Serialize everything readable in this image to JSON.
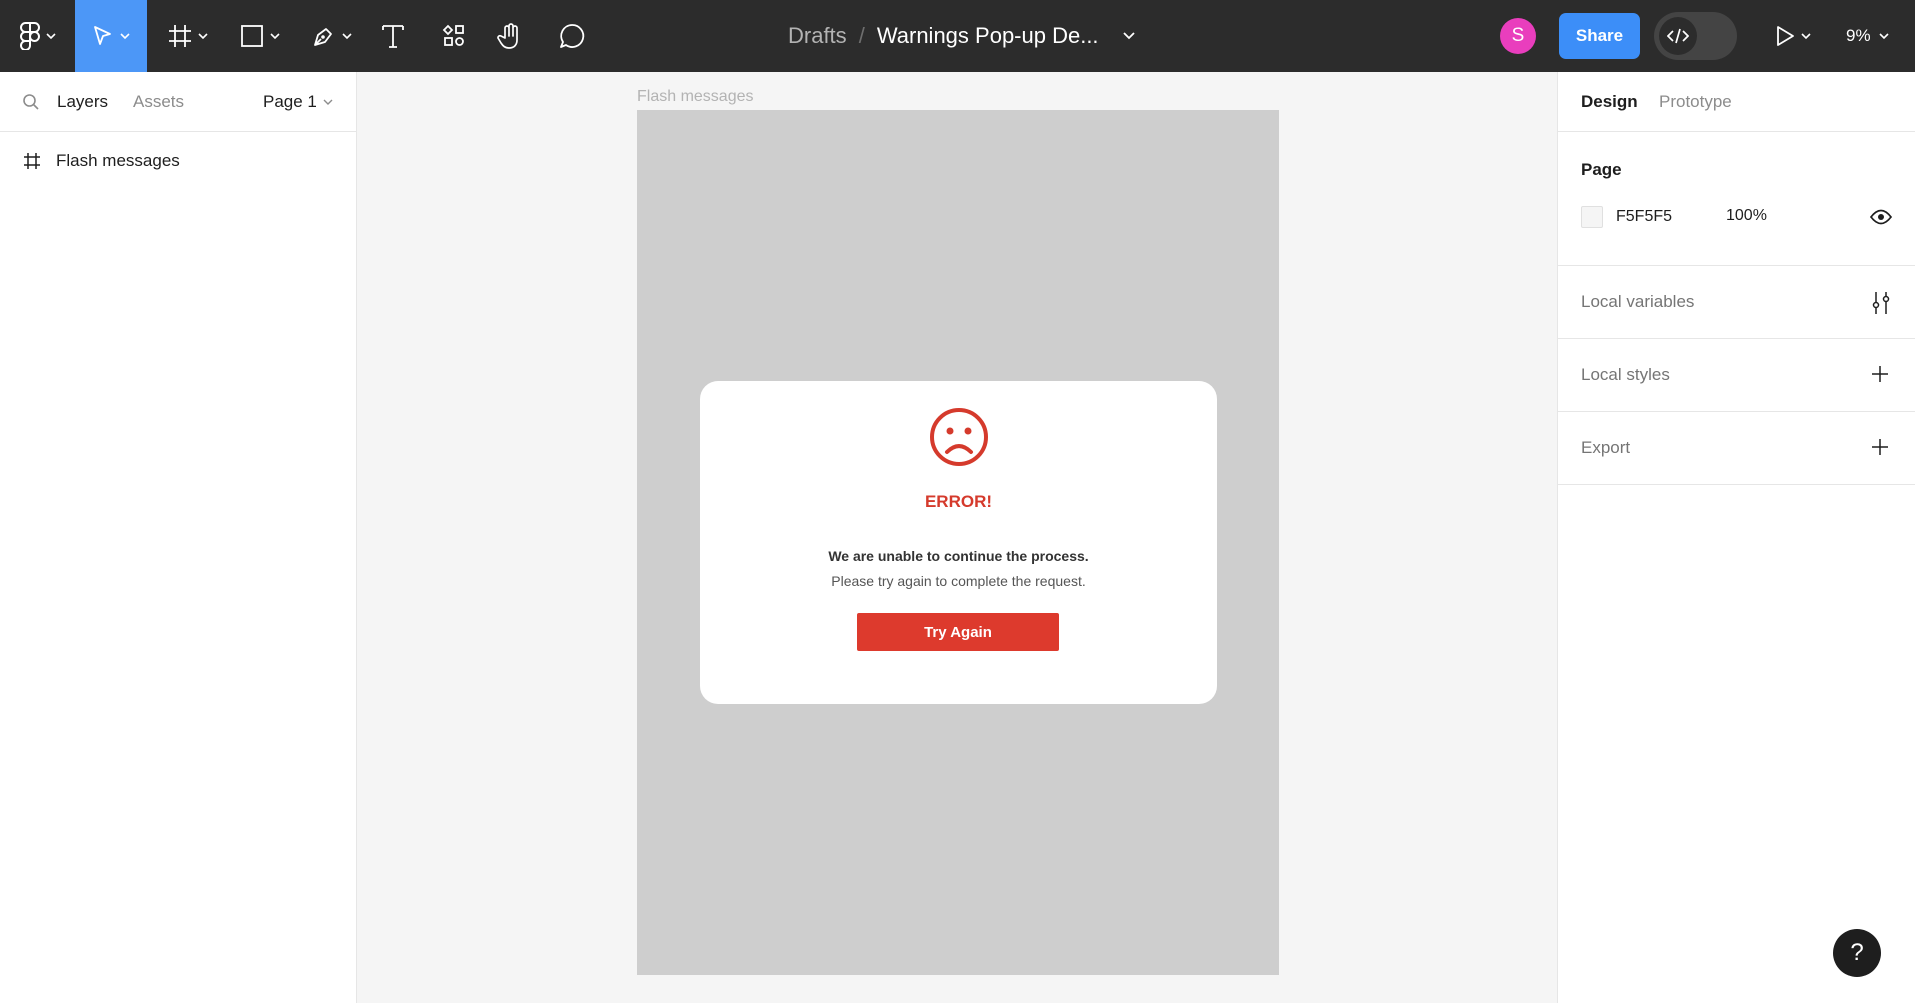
{
  "toolbar": {
    "breadcrumb_parent": "Drafts",
    "breadcrumb_separator": "/",
    "file_name": "Warnings Pop-up De...",
    "avatar_initial": "S",
    "share_label": "Share",
    "zoom_label": "9%",
    "tools": [
      "main-menu",
      "move",
      "frame",
      "rectangle",
      "pen",
      "text",
      "resources",
      "hand",
      "comment"
    ]
  },
  "left_panel": {
    "tab_layers": "Layers",
    "tab_assets": "Assets",
    "page_selector": "Page 1",
    "layers": [
      {
        "icon": "frame-icon",
        "name": "Flash messages"
      }
    ]
  },
  "canvas": {
    "frame_label": "Flash messages",
    "modal": {
      "icon": "sad-face-icon",
      "title": "ERROR!",
      "line1": "We are unable to continue the process.",
      "line2": "Please try again to complete the request.",
      "button_label": "Try Again"
    },
    "colors": {
      "frame_bg": "#cecece",
      "error_red": "#dd3a2d"
    }
  },
  "right_panel": {
    "tab_design": "Design",
    "tab_prototype": "Prototype",
    "page_section_title": "Page",
    "page_fill_hex": "F5F5F5",
    "page_fill_opacity": "100%",
    "local_variables": "Local variables",
    "local_styles": "Local styles",
    "export": "Export"
  },
  "help_label": "?"
}
